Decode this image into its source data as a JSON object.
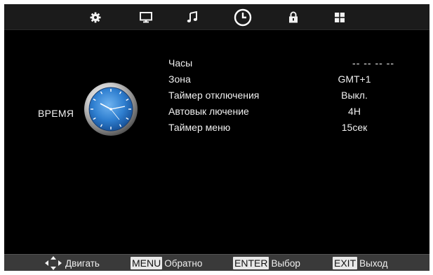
{
  "tabs": [
    {
      "name": "settings",
      "icon": "gear-icon"
    },
    {
      "name": "picture",
      "icon": "monitor-icon"
    },
    {
      "name": "sound",
      "icon": "music-note-icon"
    },
    {
      "name": "time",
      "icon": "clock-icon",
      "active": true
    },
    {
      "name": "lock",
      "icon": "lock-icon"
    },
    {
      "name": "setup",
      "icon": "grid-icon"
    }
  ],
  "section": {
    "label": "ВРЕМЯ",
    "icon": "analog-clock-icon"
  },
  "rows": [
    {
      "label": "Часы",
      "value": "-- -- -- --"
    },
    {
      "label": "Зона",
      "value": "GMT+1"
    },
    {
      "label": "Таймер отключения",
      "value": "Выкл."
    },
    {
      "label": "Автовык лючение",
      "value": "4H"
    },
    {
      "label": "Таймер меню",
      "value": "15сек"
    }
  ],
  "footer": {
    "move": {
      "icon": "four-way-arrows-icon",
      "label": "Двигать"
    },
    "menu": {
      "key": "MENU",
      "label": "Обратно"
    },
    "enter": {
      "key": "ENTER",
      "label": "Выбор"
    },
    "exit": {
      "key": "EXIT",
      "label": "Выход"
    }
  },
  "colors": {
    "background": "#000000",
    "bar": "#1b1b1b",
    "footer": "#3a3a3a",
    "text": "#f0f0f0",
    "clock_face": "#2f7fd0"
  }
}
